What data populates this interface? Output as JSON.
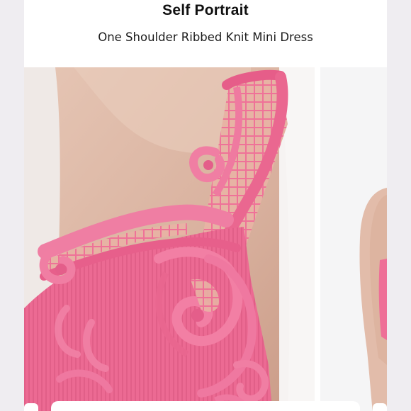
{
  "header": {
    "brand": "Self Portrait",
    "product_name": "One Shoulder Ribbed Knit Mini Dress"
  },
  "gallery": {
    "main_image": "pink-lace-knit-dress-closeup",
    "next_image": "pink-dress-model-side"
  },
  "colors": {
    "dress_pink": "#ee6f97",
    "skin": "#dcb8a7",
    "backdrop": "#efedf1"
  }
}
